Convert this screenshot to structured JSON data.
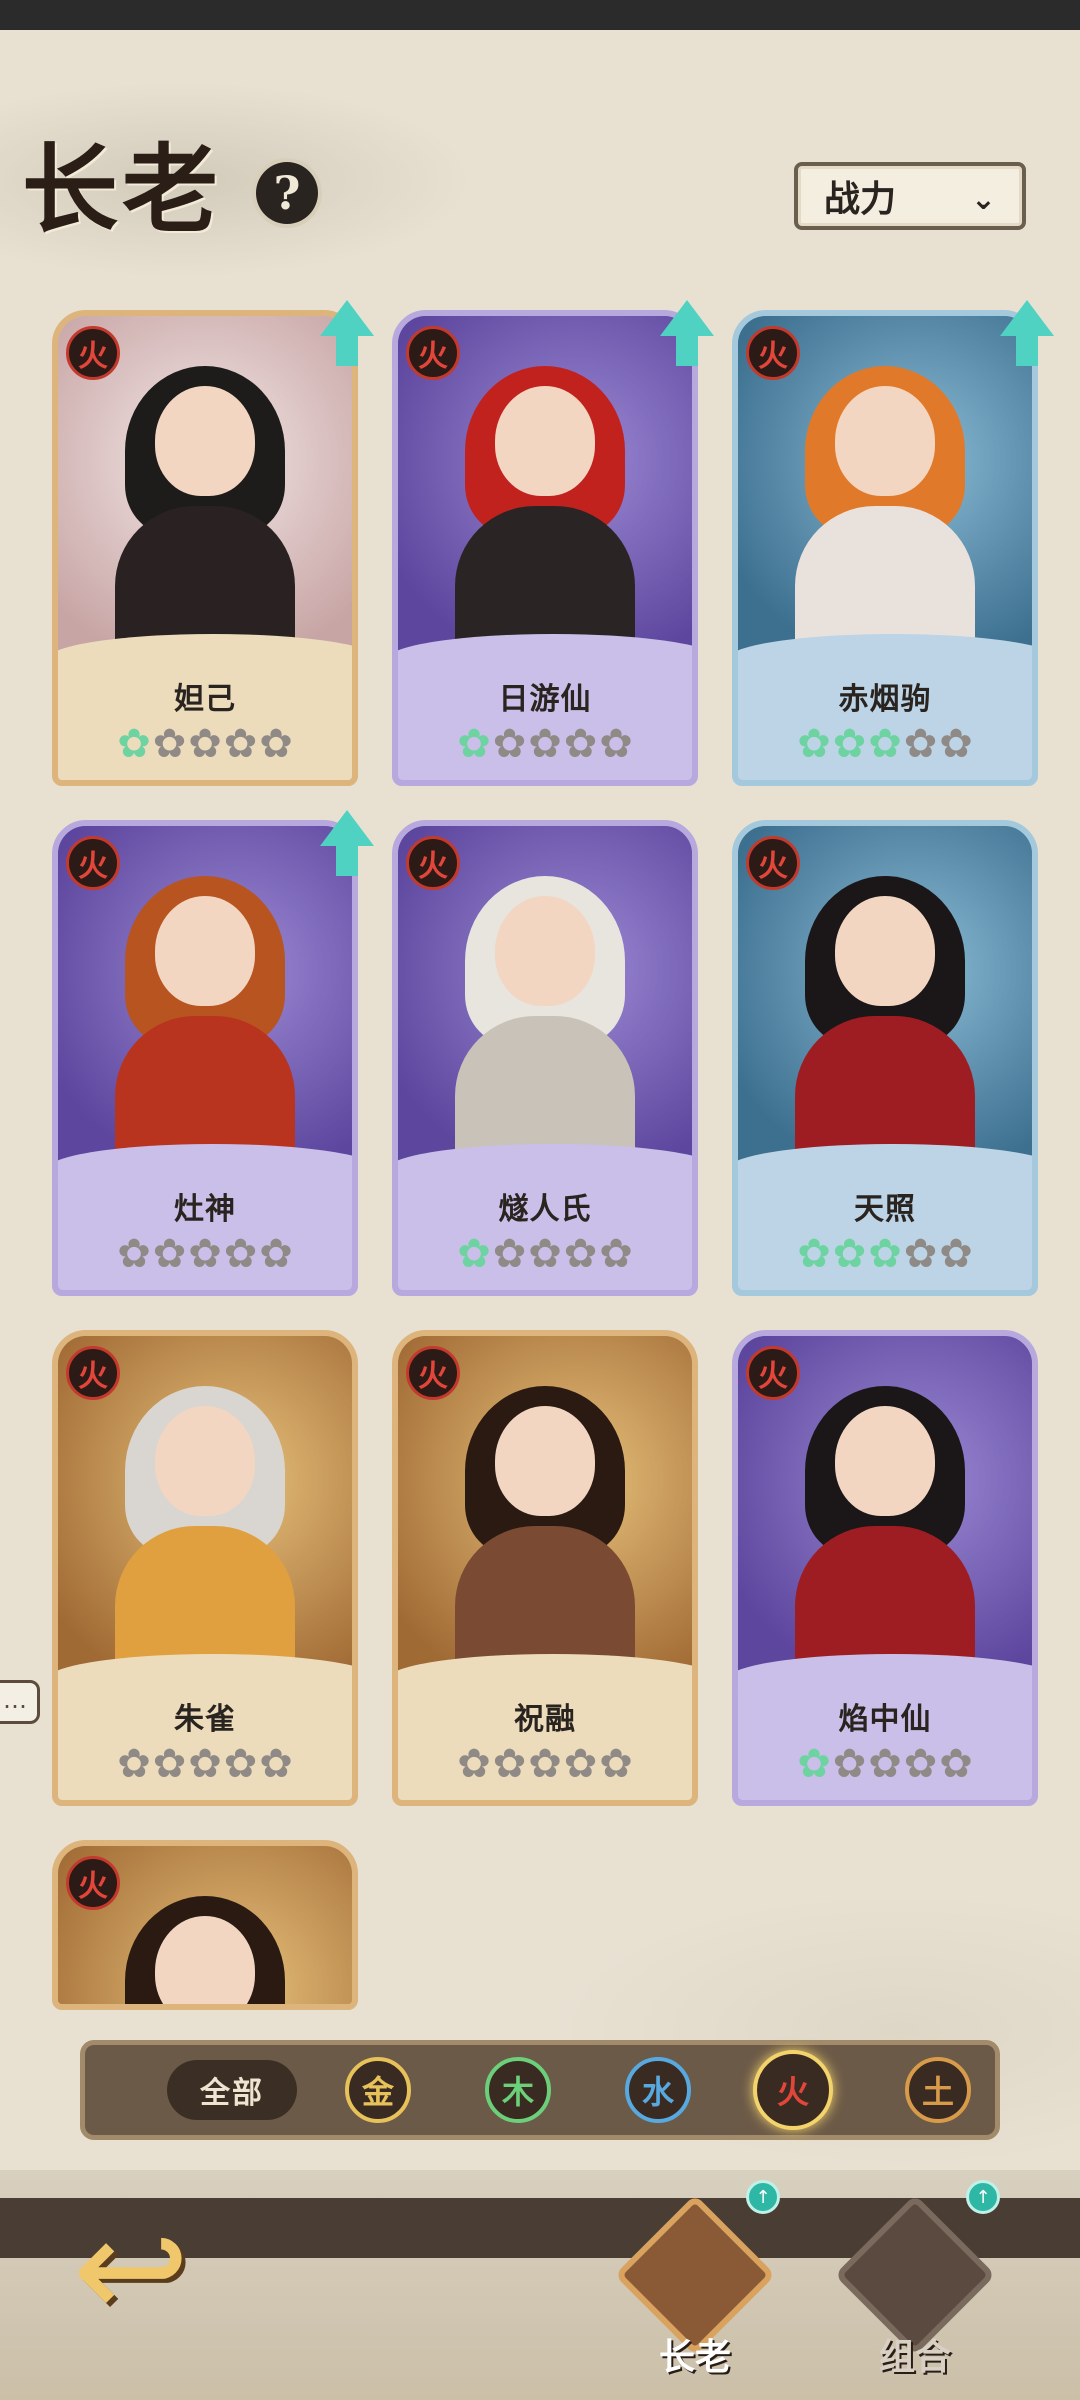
{
  "header": {
    "title": "长老",
    "help_label": "?",
    "sort_label": "战力",
    "sort_chevron": "⌄"
  },
  "cards": [
    {
      "name": "妲己",
      "element": "火",
      "stars_filled": 1,
      "stars_total": 5,
      "upgradable": true,
      "frame": "pale"
    },
    {
      "name": "日游仙",
      "element": "火",
      "stars_filled": 1,
      "stars_total": 5,
      "upgradable": true,
      "frame": "purple"
    },
    {
      "name": "赤烟驹",
      "element": "火",
      "stars_filled": 3,
      "stars_total": 5,
      "upgradable": true,
      "frame": "blue"
    },
    {
      "name": "灶神",
      "element": "火",
      "stars_filled": 0,
      "stars_total": 5,
      "upgradable": true,
      "frame": "purple"
    },
    {
      "name": "燧人氏",
      "element": "火",
      "stars_filled": 1,
      "stars_total": 5,
      "upgradable": false,
      "frame": "purple"
    },
    {
      "name": "天照",
      "element": "火",
      "stars_filled": 3,
      "stars_total": 5,
      "upgradable": false,
      "frame": "blue"
    },
    {
      "name": "朱雀",
      "element": "火",
      "stars_filled": 0,
      "stars_total": 5,
      "upgradable": false,
      "frame": "gold"
    },
    {
      "name": "祝融",
      "element": "火",
      "stars_filled": 0,
      "stars_total": 5,
      "upgradable": false,
      "frame": "gold"
    },
    {
      "name": "焰中仙",
      "element": "火",
      "stars_filled": 1,
      "stars_total": 5,
      "upgradable": false,
      "frame": "purple"
    },
    {
      "name": "",
      "element": "火",
      "stars_filled": 0,
      "stars_total": 0,
      "upgradable": false,
      "frame": "gold"
    }
  ],
  "filter": {
    "all_label": "全部",
    "elements": [
      "金",
      "木",
      "水",
      "火",
      "土"
    ],
    "element_colors": [
      "#e7c15a",
      "#6cd07a",
      "#58a9e0",
      "#e2463a",
      "#d79b4a"
    ],
    "selected": "火"
  },
  "nav": {
    "back_glyph": "↩",
    "tabs": [
      {
        "label": "长老",
        "badge": "↑",
        "active": true
      },
      {
        "label": "组合",
        "badge": "↑",
        "active": false
      }
    ]
  },
  "misc": {
    "chat_glyph": "…"
  },
  "colors": {
    "star_on": "#6dd3a0",
    "star_off": "#8f8a86",
    "upgrade_arrow": "#4fd2c2"
  }
}
